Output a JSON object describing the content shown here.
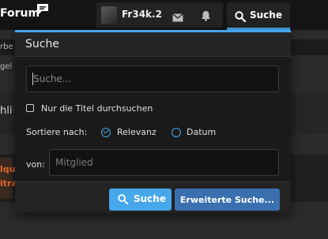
{
  "topbar": {
    "forum_label": "Forum",
    "username": "Fr34k.2",
    "search_label": "Suche"
  },
  "background": {
    "frag1": "rbe",
    "frag2": "gel",
    "frag3": "hli",
    "frag4_line1": "lqu",
    "frag4_line2": "itra"
  },
  "search_menu": {
    "title": "Suche",
    "query_placeholder": "Suche...",
    "titles_only_label": "Nur die Titel durchsuchen",
    "sort_label": "Sortiere nach:",
    "sort_options": [
      "Relevanz",
      "Datum"
    ],
    "sort_selected": "Relevanz",
    "member_label": "von:",
    "member_placeholder": "Mitglied",
    "search_button": "Suche",
    "advanced_button": "Erweiterte Suche..."
  },
  "colors": {
    "accent": "#47a7eb",
    "advanced_button": "#3a6fb0",
    "background_highlight": "#e86a2c"
  }
}
